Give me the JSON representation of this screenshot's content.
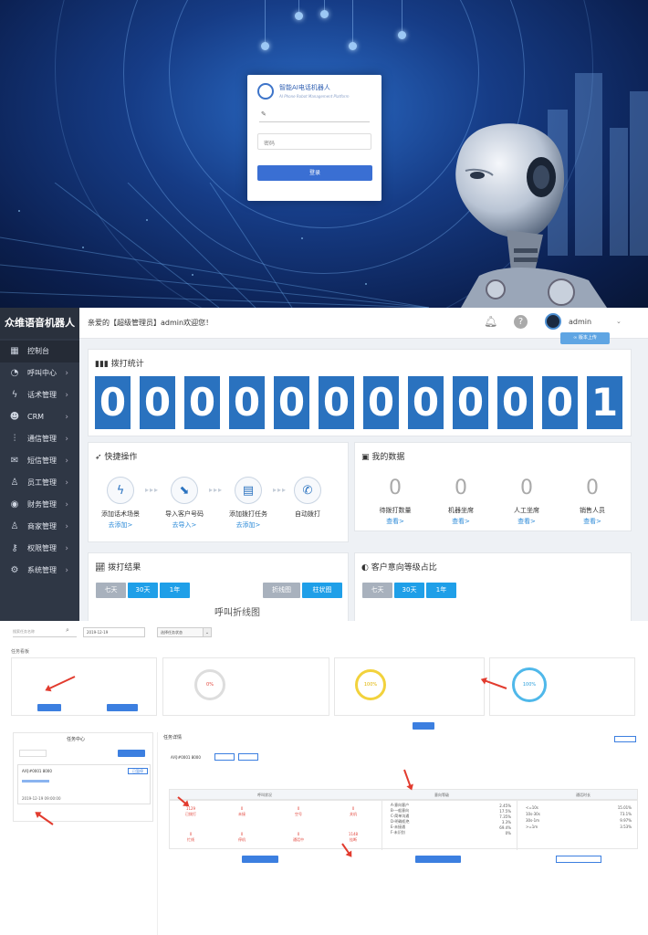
{
  "login": {
    "title": "智能AI电话机器人",
    "subtitle": "AI Phone Robot Management Platform",
    "password_placeholder": "密码",
    "submit_label": "登录"
  },
  "dashboard": {
    "brand": "众维语音机器人",
    "welcome": "亲爱的【超级管理员】admin欢迎您！",
    "username": "admin",
    "upload_label": "版本上传",
    "sidebar": [
      {
        "label": "控制台",
        "icon": "grid-icon",
        "active": true
      },
      {
        "label": "呼叫中心",
        "icon": "clock-icon"
      },
      {
        "label": "话术管理",
        "icon": "bolt-icon"
      },
      {
        "label": "CRM",
        "icon": "people-icon"
      },
      {
        "label": "通信管理",
        "icon": "sliders-icon"
      },
      {
        "label": "短信管理",
        "icon": "mail-icon"
      },
      {
        "label": "员工管理",
        "icon": "user-icon"
      },
      {
        "label": "财务管理",
        "icon": "coin-icon"
      },
      {
        "label": "商家管理",
        "icon": "user-icon"
      },
      {
        "label": "权限管理",
        "icon": "key-icon"
      },
      {
        "label": "系统管理",
        "icon": "gear-icon"
      }
    ],
    "dial_stats": {
      "title": "拨打统计",
      "digits": [
        "0",
        "0",
        "0",
        "0",
        "0",
        "0",
        "0",
        "0",
        "0",
        "0",
        "0",
        "1"
      ]
    },
    "quick_ops": {
      "title": "快捷操作",
      "items": [
        {
          "label": "添加话术场景",
          "link": "去添加>"
        },
        {
          "label": "导入客户号码",
          "link": "去导入>"
        },
        {
          "label": "添加拨打任务",
          "link": "去添加>"
        },
        {
          "label": "自动拨打",
          "link": ""
        }
      ]
    },
    "my_data": {
      "title": "我的数据",
      "items": [
        {
          "value": "0",
          "label": "待拨打数量",
          "link": "查看>"
        },
        {
          "value": "0",
          "label": "机器坐席",
          "link": "查看>"
        },
        {
          "value": "0",
          "label": "人工坐席",
          "link": "查看>"
        },
        {
          "value": "0",
          "label": "销售人员",
          "link": "查看>"
        }
      ]
    },
    "dial_result": {
      "title": "拨打结果",
      "ranges": [
        "七天",
        "30天",
        "1年"
      ],
      "chart_types": [
        "折线图",
        "柱状图"
      ],
      "chart_label": "呼叫折线图"
    },
    "intent": {
      "title": "客户意向等级占比",
      "ranges": [
        "七天",
        "30天",
        "1年"
      ]
    }
  },
  "task": {
    "search_placeholder": "搜索任务名称",
    "date": "2019-12-19",
    "select_value": "选择任务状态",
    "section_label": "任务看板",
    "call_center_title": "任务中心",
    "card_name": "AI号#0001 8000",
    "card_status": "已暂停",
    "card_date": "2019-12-19 09:00:00",
    "detail_title": "任务详情",
    "detail_name": "AI号#0001 8000",
    "table_heads": [
      "呼叫状况",
      "意向等级",
      "通话时长"
    ],
    "intent_rows": [
      {
        "k": "A-意向客户",
        "v": "2.45%"
      },
      {
        "k": "B-一般意向",
        "v": "17.5%"
      },
      {
        "k": "C-简单沟通",
        "v": "7.35%"
      },
      {
        "k": "D-明确拒绝",
        "v": "3.3%"
      },
      {
        "k": "E-未接通",
        "v": "69.4%"
      },
      {
        "k": "F-未识别",
        "v": "0%"
      }
    ],
    "duration_rows": [
      {
        "k": "<=10s",
        "v": "15.01%"
      },
      {
        "k": "10s-30s",
        "v": "73.1%"
      },
      {
        "k": "30s-1m",
        "v": "9.97%"
      },
      {
        "k": ">=1m",
        "v": "3.53%"
      }
    ],
    "call_cells": [
      {
        "v": "1129",
        "k": "已拨打"
      },
      {
        "v": "0",
        "k": "未接"
      },
      {
        "v": "0",
        "k": "空号"
      },
      {
        "v": "0",
        "k": "关机"
      },
      {
        "v": "0",
        "k": "忙线"
      },
      {
        "v": "0",
        "k": "停机"
      },
      {
        "v": "0",
        "k": "通话中"
      },
      {
        "v": "1148",
        "k": "挂断"
      }
    ],
    "rings": [
      {
        "value": "0%",
        "color": "#d9d9d9"
      },
      {
        "value": "100%",
        "color": "#f2d23c"
      },
      {
        "value": "100%",
        "color": "#4fb8ea"
      }
    ],
    "colors": {
      "accent": "#3c7fe0",
      "arrow": "#e23b2e"
    }
  }
}
